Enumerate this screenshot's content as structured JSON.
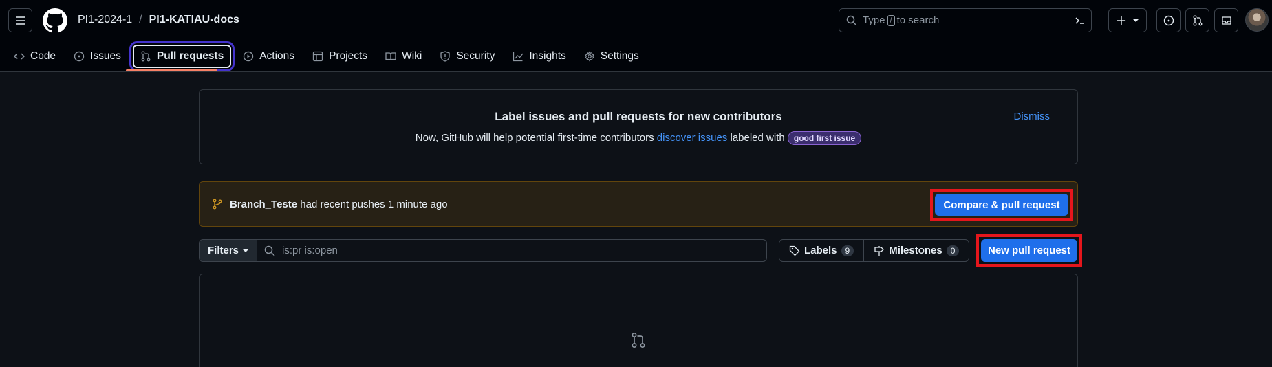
{
  "header": {
    "owner": "PI1-2024-1",
    "separator": "/",
    "repo": "PI1-KATIAU-docs",
    "search": {
      "prefix": "Type",
      "key": "/",
      "suffix": "to search"
    }
  },
  "nav": {
    "items": [
      {
        "label": "Code",
        "icon": "code-icon"
      },
      {
        "label": "Issues",
        "icon": "issue-opened-icon"
      },
      {
        "label": "Pull requests",
        "icon": "git-pull-request-icon"
      },
      {
        "label": "Actions",
        "icon": "play-icon"
      },
      {
        "label": "Projects",
        "icon": "table-icon"
      },
      {
        "label": "Wiki",
        "icon": "book-icon"
      },
      {
        "label": "Security",
        "icon": "shield-icon"
      },
      {
        "label": "Insights",
        "icon": "graph-icon"
      },
      {
        "label": "Settings",
        "icon": "gear-icon"
      }
    ],
    "active": "Pull requests"
  },
  "banner": {
    "title": "Label issues and pull requests for new contributors",
    "text_before": "Now, GitHub will help potential first-time contributors",
    "link": "discover issues",
    "text_after": "labeled with",
    "label": "good first issue",
    "dismiss": "Dismiss"
  },
  "recent_push": {
    "branch": "Branch_Teste",
    "text": "had recent pushes 1 minute ago",
    "button": "Compare & pull request"
  },
  "toolbar": {
    "filters": "Filters",
    "query": "is:pr is:open",
    "labels": "Labels",
    "labels_count": "9",
    "milestones": "Milestones",
    "milestones_count": "0",
    "new_pr": "New pull request"
  },
  "colors": {
    "accent": "#1f6feb",
    "link": "#4493f8",
    "highlight_red": "#e5161c",
    "highlight_blue": "#4433cc",
    "background": "#0d1117"
  }
}
